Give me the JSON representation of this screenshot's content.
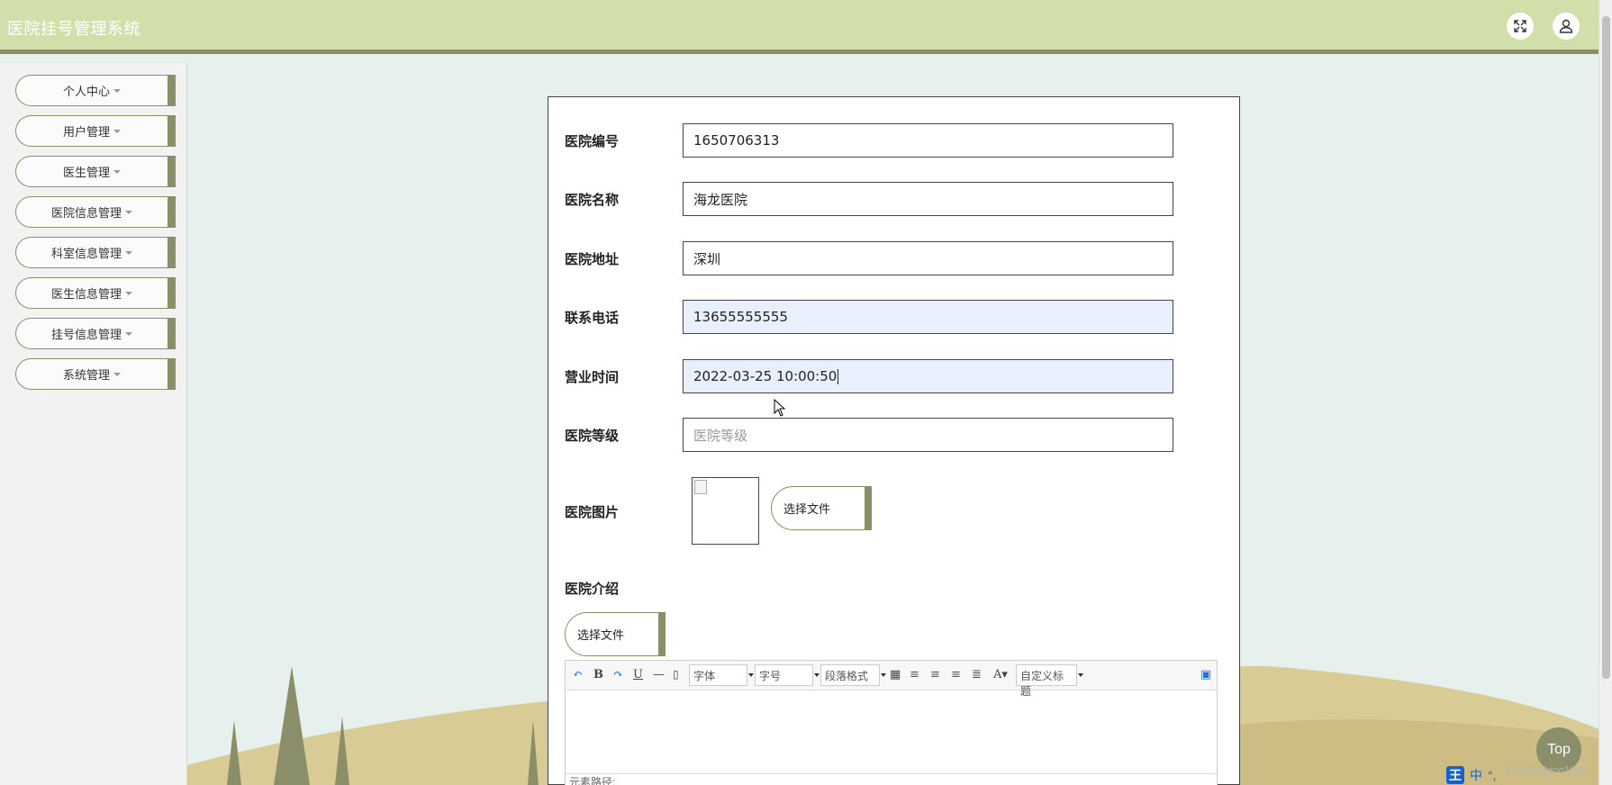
{
  "app": {
    "title": "医院挂号管理系统"
  },
  "header": {
    "icons": [
      "fullscreen-icon",
      "user-icon"
    ]
  },
  "sidebar": {
    "items": [
      {
        "label": "个人中心"
      },
      {
        "label": "用户管理"
      },
      {
        "label": "医生管理"
      },
      {
        "label": "医院信息管理"
      },
      {
        "label": "科室信息管理"
      },
      {
        "label": "医生信息管理"
      },
      {
        "label": "挂号信息管理"
      },
      {
        "label": "系统管理"
      }
    ]
  },
  "form": {
    "hospital_id": {
      "label": "医院编号",
      "value": "1650706313"
    },
    "hospital_name": {
      "label": "医院名称",
      "value": "海龙医院"
    },
    "hospital_address": {
      "label": "医院地址",
      "value": "深圳"
    },
    "phone": {
      "label": "联系电话",
      "value": "13655555555"
    },
    "business_hours": {
      "label": "营业时间",
      "value": "2022-03-25 10:00:50"
    },
    "hospital_level": {
      "label": "医院等级",
      "placeholder": "医院等级"
    },
    "hospital_image": {
      "label": "医院图片",
      "button": "选择文件"
    },
    "hospital_intro": {
      "label": "医院介绍",
      "button": "选择文件"
    }
  },
  "editor": {
    "toolbar": {
      "font_family": "字体",
      "font_size": "字号",
      "paragraph": "段落格式",
      "custom_title": "自定义标题"
    },
    "footer": "元素路径:"
  },
  "top_button": "Top",
  "watermark": "CSDN @ano1015",
  "tray": {
    "ime": "王",
    "lang": "中"
  }
}
